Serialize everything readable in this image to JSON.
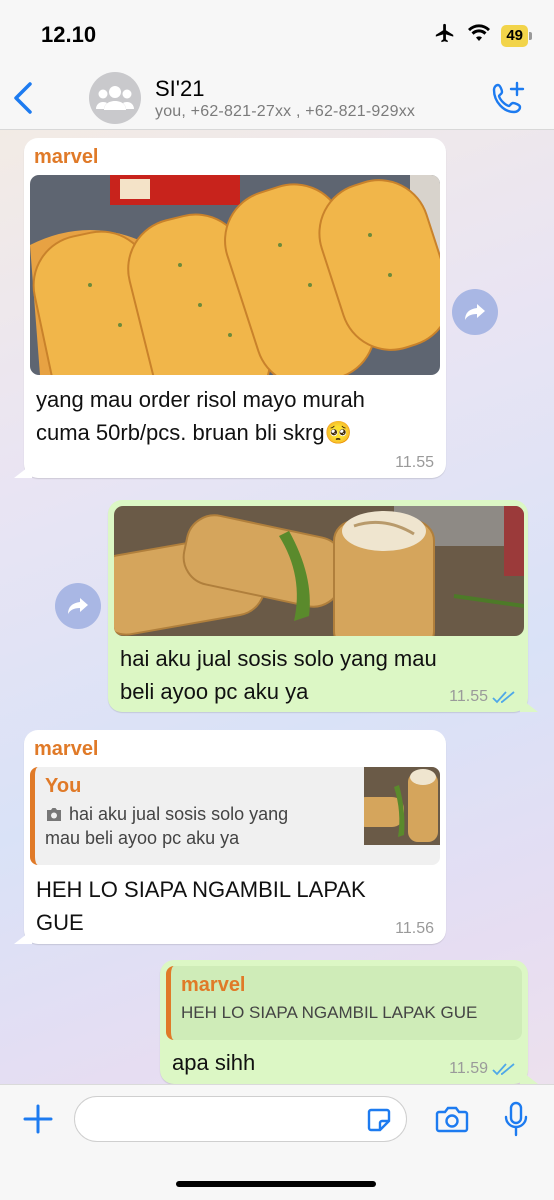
{
  "status": {
    "time": "12.10",
    "battery": "49"
  },
  "header": {
    "title": "SI'21",
    "subtitle": "you, +62-821-27xx , +62-821-929xx"
  },
  "messages": [
    {
      "sender": "marvel",
      "text_line1": "yang mau order risol mayo murah",
      "text_line2": "cuma 50rb/pcs. bruan bli skrg🥺",
      "time": "11.55"
    },
    {
      "text_line1": "hai aku jual sosis solo yang mau",
      "text_line2": "beli ayoo pc aku ya",
      "time": "11.55"
    },
    {
      "sender": "marvel",
      "quote_name": "You",
      "quote_line1": "hai aku jual sosis solo yang",
      "quote_line2": "mau beli ayoo pc aku ya",
      "text_line1": "HEH LO SIAPA NGAMBIL LAPAK",
      "text_line2": "GUE",
      "time": "11.56"
    },
    {
      "quote_name": "marvel",
      "quote_text": "HEH LO SIAPA NGAMBIL LAPAK GUE",
      "text": "apa sihh",
      "time": "11.59"
    }
  ],
  "colors": {
    "accent": "#1d7bf0",
    "sender": "#e07a28",
    "outgoing": "#dcf7c5",
    "read_tick": "#4fa8e8"
  },
  "icons": [
    "airplane-icon",
    "wifi-icon",
    "back-icon",
    "group-icon",
    "add-call-icon",
    "forward-icon",
    "camera-icon",
    "plus-icon",
    "sticker-icon",
    "mic-icon",
    "read-tick-icon"
  ]
}
